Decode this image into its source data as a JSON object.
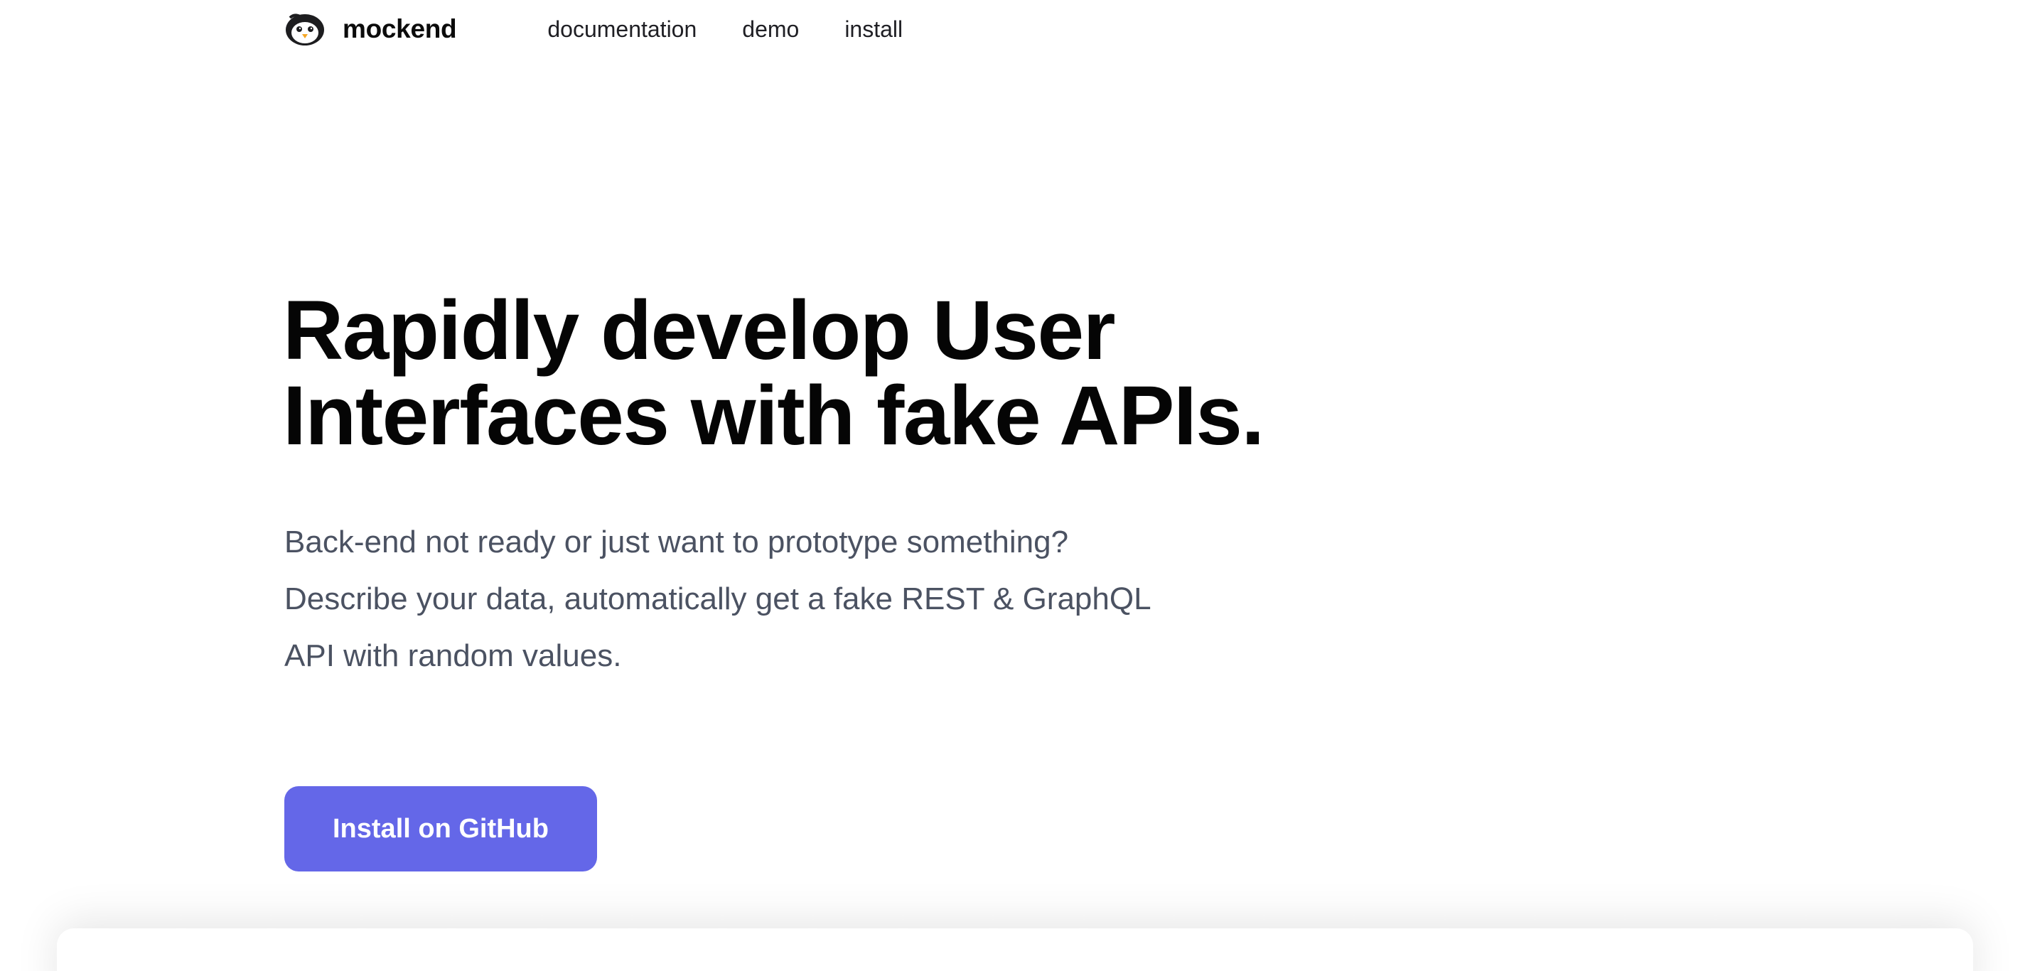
{
  "header": {
    "brand": "mockend",
    "logo_icon": "penguin-logo-icon",
    "nav": [
      "documentation",
      "demo",
      "install"
    ]
  },
  "hero": {
    "title_lines": [
      "Rapidly develop User",
      "Interfaces with fake APIs."
    ],
    "subtitle_lines": [
      "Back-end not ready or just want to prototype something?",
      "Describe your data, automatically get a fake REST & GraphQL",
      "API with random values."
    ],
    "cta_label": "Install on GitHub"
  },
  "colors": {
    "accent": "#6467e8",
    "title": "#050505",
    "subtitle": "#4b5262",
    "background": "#ffffff"
  }
}
